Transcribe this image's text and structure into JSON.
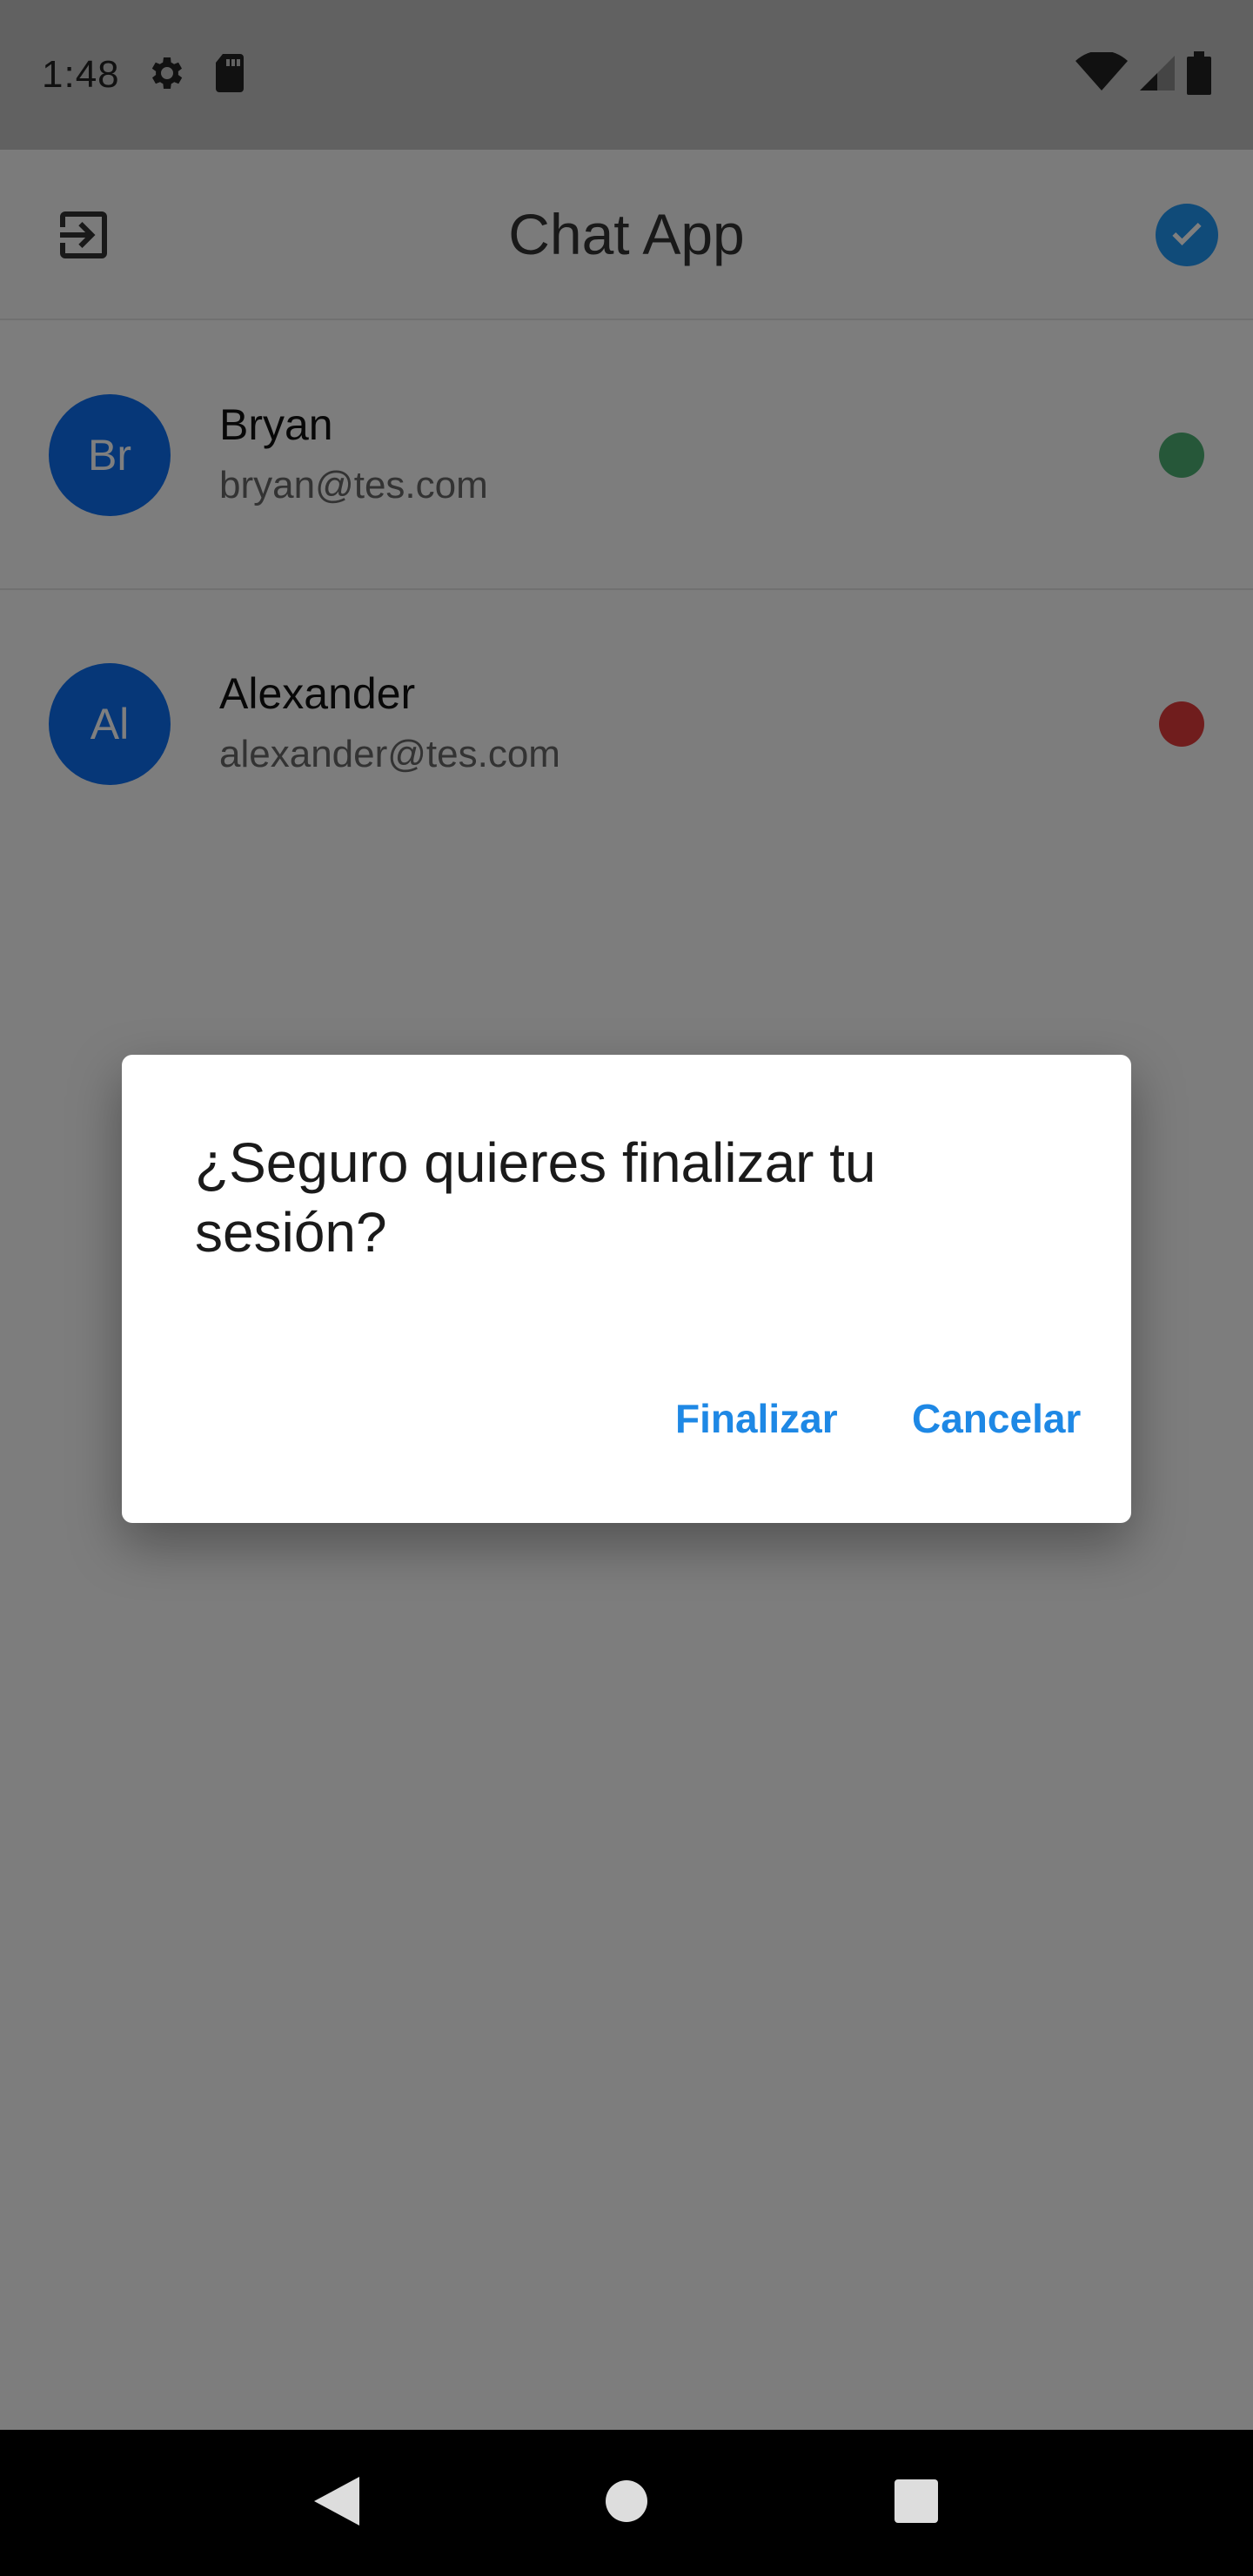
{
  "status_bar": {
    "time": "1:48",
    "icons": [
      "gear-icon",
      "sd-card-icon",
      "wifi-icon",
      "signal-icon",
      "battery-icon"
    ]
  },
  "app_bar": {
    "title": "Chat App",
    "left_icon": "exit-icon",
    "right_icon": "check-circle-icon"
  },
  "users": [
    {
      "initials": "Br",
      "name": "Bryan",
      "email": "bryan@tes.com",
      "online": true
    },
    {
      "initials": "Al",
      "name": "Alexander",
      "email": "alexander@tes.com",
      "online": false
    }
  ],
  "dialog": {
    "title": "¿Seguro quieres finalizar tu sesión?",
    "confirm_label": "Finalizar",
    "cancel_label": "Cancelar"
  },
  "nav_bar": {
    "buttons": [
      "back-icon",
      "home-icon",
      "recents-icon"
    ]
  },
  "colors": {
    "accent": "#1e88e5",
    "avatar": "#0d6ef0",
    "online": "#4caf73",
    "offline": "#e03a3a"
  }
}
